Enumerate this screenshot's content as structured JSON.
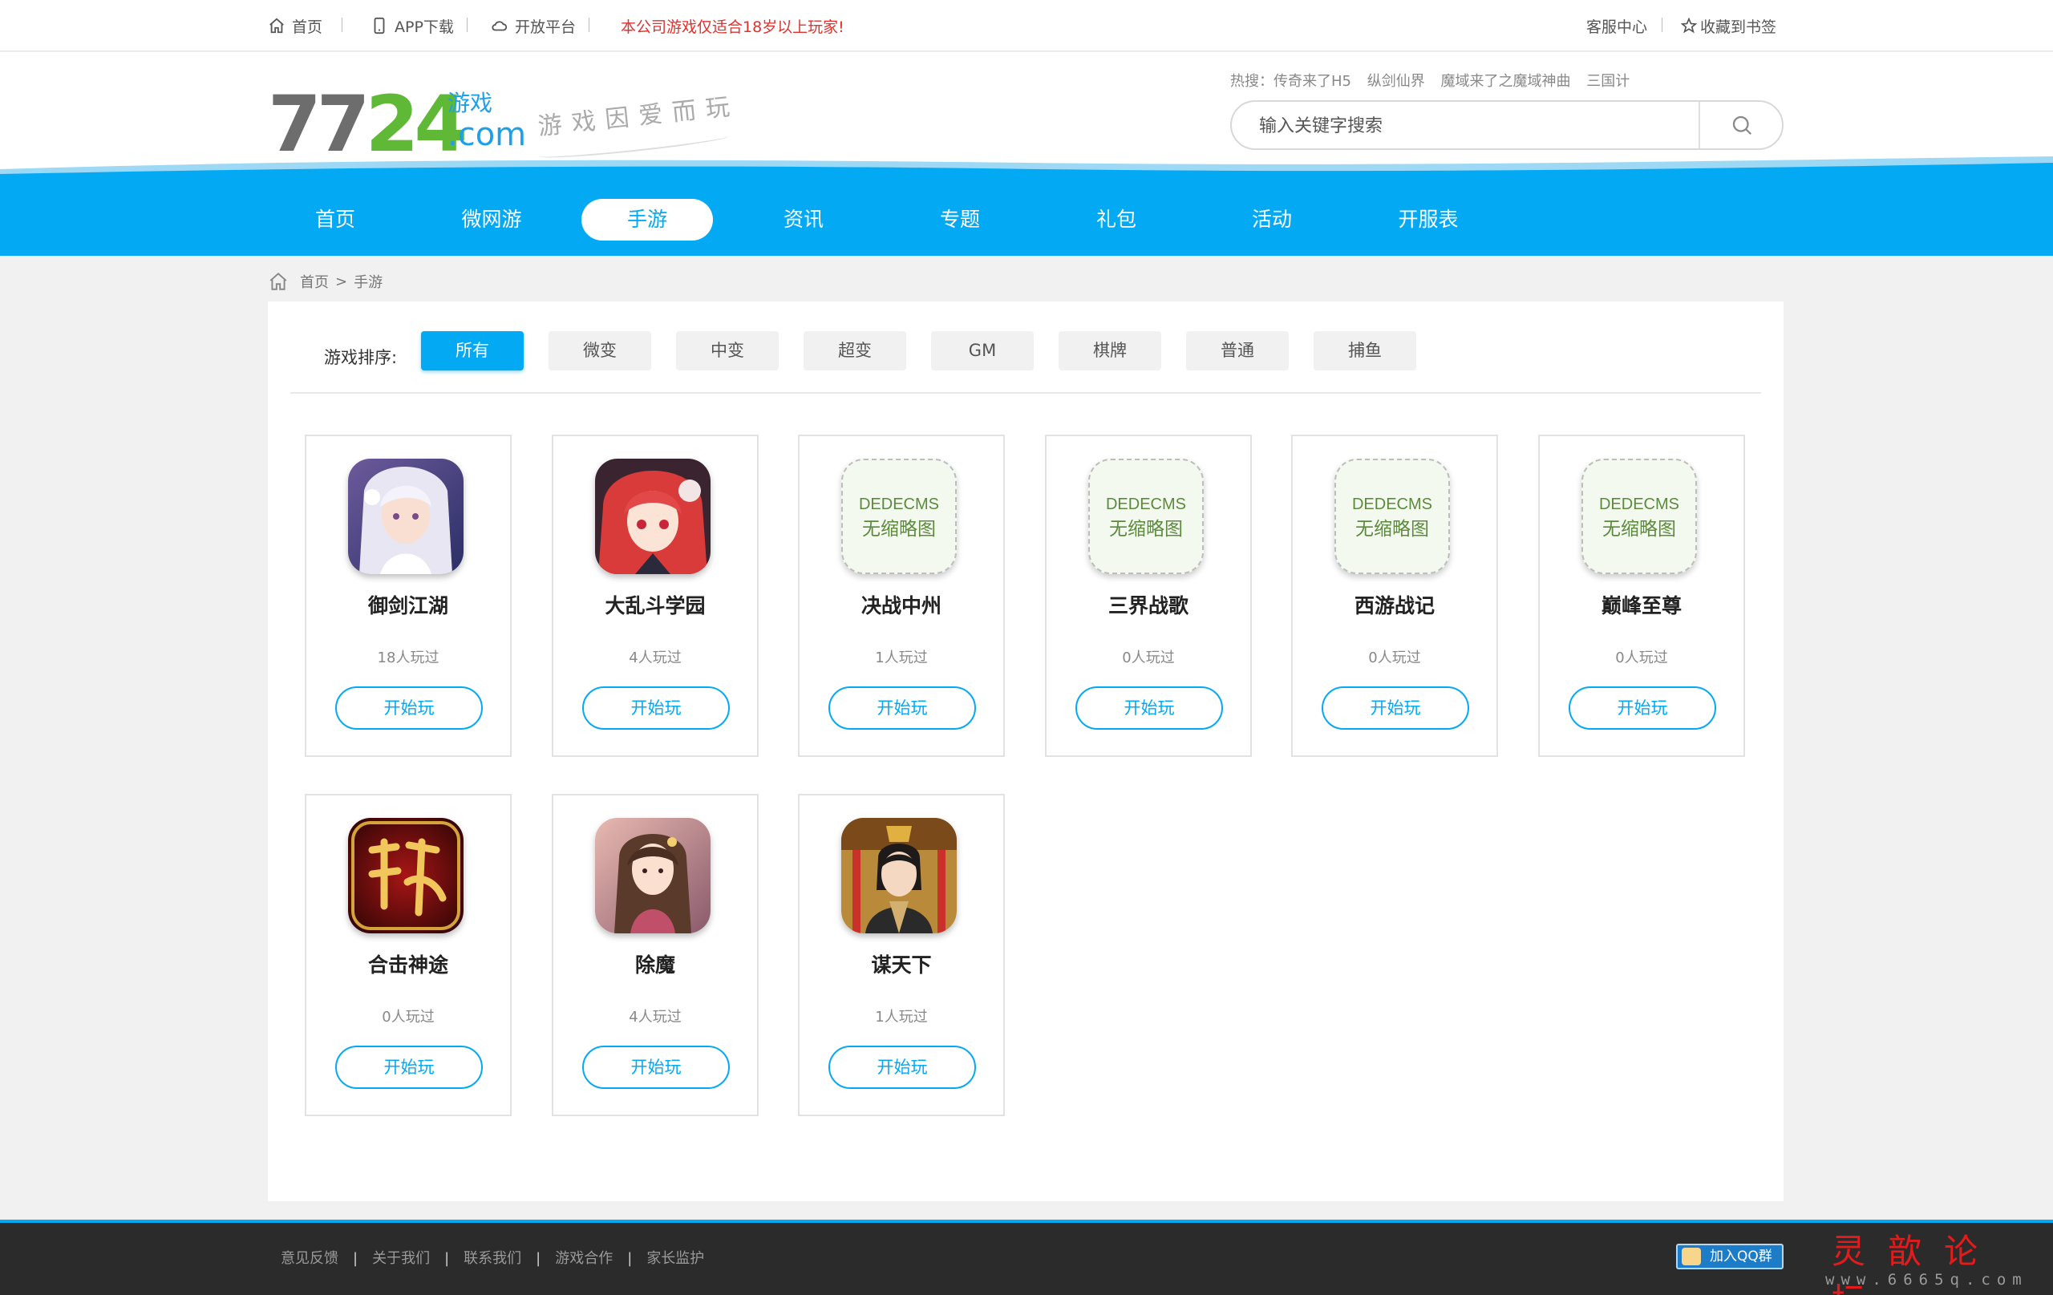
{
  "topbar": {
    "home": "首页",
    "app": "APP下载",
    "open": "开放平台",
    "warning": "本公司游戏仅适合18岁以上玩家!",
    "service": "客服中心",
    "bookmark": "收藏到书签"
  },
  "header": {
    "logo_num_a": "77",
    "logo_num_b": "24",
    "logo_game": "游戏",
    "logo_com": ".com",
    "slogan": "游戏因爱而玩",
    "hot_label": "热搜：",
    "hot": [
      "传奇来了H5",
      "纵剑仙界",
      "魔域来了之魔域神曲",
      "三国计"
    ],
    "search_placeholder": "输入关键字搜索"
  },
  "nav": [
    {
      "label": "首页"
    },
    {
      "label": "微网游"
    },
    {
      "label": "手游",
      "active": true
    },
    {
      "label": "资讯"
    },
    {
      "label": "专题"
    },
    {
      "label": "礼包"
    },
    {
      "label": "活动"
    },
    {
      "label": "开服表"
    }
  ],
  "breadcrumb": {
    "home": "首页",
    "sep": ">",
    "current": "手游"
  },
  "sort": {
    "label": "游戏排序:",
    "options": [
      "所有",
      "微变",
      "中变",
      "超变",
      "GM",
      "棋牌",
      "普通",
      "捕鱼"
    ],
    "active": "所有"
  },
  "games": [
    {
      "name": "御剑江湖",
      "plays": "18人玩过",
      "button": "开始玩",
      "thumb": "art-girl-white"
    },
    {
      "name": "大乱斗学园",
      "plays": "4人玩过",
      "button": "开始玩",
      "thumb": "art-girl-red"
    },
    {
      "name": "决战中州",
      "plays": "1人玩过",
      "button": "开始玩",
      "thumb": "placeholder",
      "ph1": "DEDECMS",
      "ph2": "无缩略图"
    },
    {
      "name": "三界战歌",
      "plays": "0人玩过",
      "button": "开始玩",
      "thumb": "placeholder",
      "ph1": "DEDECMS",
      "ph2": "无缩略图"
    },
    {
      "name": "西游战记",
      "plays": "0人玩过",
      "button": "开始玩",
      "thumb": "placeholder",
      "ph1": "DEDECMS",
      "ph2": "无缩略图"
    },
    {
      "name": "巅峰至尊",
      "plays": "0人玩过",
      "button": "开始玩",
      "thumb": "placeholder",
      "ph1": "DEDECMS",
      "ph2": "无缩略图"
    },
    {
      "name": "合击神途",
      "plays": "0人玩过",
      "button": "开始玩",
      "thumb": "art-calligraphy"
    },
    {
      "name": "除魔",
      "plays": "4人玩过",
      "button": "开始玩",
      "thumb": "art-girl-pink"
    },
    {
      "name": "谋天下",
      "plays": "1人玩过",
      "button": "开始玩",
      "thumb": "art-emperor"
    }
  ],
  "footer": {
    "links": [
      "意见反馈",
      "关于我们",
      "联系我们",
      "游戏合作",
      "家长监护"
    ],
    "qq": "加入QQ群",
    "watermark_title": "灵歆论坛",
    "watermark_url": "www.6665q.com"
  },
  "colors": {
    "accent": "#04a9f4",
    "warning": "#e0312c",
    "footer": "#2b2b2b"
  }
}
